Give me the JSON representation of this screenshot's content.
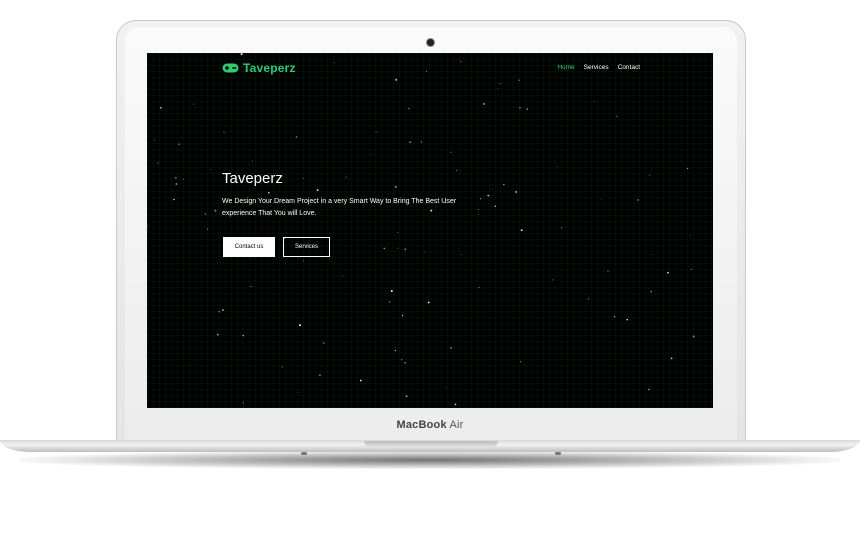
{
  "device": {
    "brand": "MacBook",
    "model": "Air"
  },
  "site": {
    "logo_text": "Taveperz",
    "nav": [
      {
        "label": "Home",
        "active": true
      },
      {
        "label": "Services",
        "active": false
      },
      {
        "label": "Contact",
        "active": false
      }
    ],
    "hero": {
      "title": "Taveperz",
      "description": "We Design Your Dream Project in a very Smart Way to Bring The Best User experience That You will Love.",
      "primary_button": "Contact us",
      "secondary_button": "Services"
    }
  },
  "colors": {
    "accent": "#2ecc71",
    "background": "#000000",
    "text": "#ffffff"
  }
}
